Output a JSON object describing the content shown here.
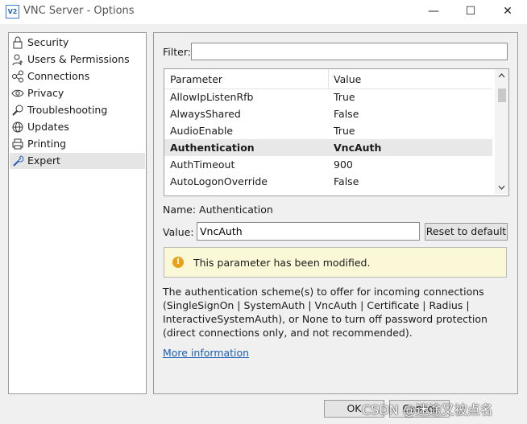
{
  "window": {
    "title": "VNC Server - Options",
    "icon_text": "V2",
    "minimize": "—",
    "maximize": "☐",
    "close": "✕"
  },
  "sidebar": {
    "items": [
      {
        "label": "Security",
        "icon": "lock-icon"
      },
      {
        "label": "Users & Permissions",
        "icon": "user-icon"
      },
      {
        "label": "Connections",
        "icon": "network-icon"
      },
      {
        "label": "Privacy",
        "icon": "eye-icon"
      },
      {
        "label": "Troubleshooting",
        "icon": "wrench-magnifier-icon"
      },
      {
        "label": "Updates",
        "icon": "globe-icon"
      },
      {
        "label": "Printing",
        "icon": "printer-icon"
      },
      {
        "label": "Expert",
        "icon": "wrench-icon"
      }
    ],
    "selected": "Expert"
  },
  "filter": {
    "label": "Filter:",
    "value": ""
  },
  "grid": {
    "headers": [
      "Parameter",
      "Value"
    ],
    "rows": [
      {
        "param": "AllowIpListenRfb",
        "value": "True"
      },
      {
        "param": "AlwaysShared",
        "value": "False"
      },
      {
        "param": "AudioEnable",
        "value": "True"
      },
      {
        "param": "Authentication",
        "value": "VncAuth"
      },
      {
        "param": "AuthTimeout",
        "value": "900"
      },
      {
        "param": "AutoLogonOverride",
        "value": "False"
      }
    ],
    "selected_row": "Authentication"
  },
  "detail": {
    "name_label": "Name: Authentication",
    "value_label": "Value:",
    "value": "VncAuth",
    "reset_button": "Reset to default",
    "warning_text": "This parameter has been modified.",
    "description": "The authentication scheme(s) to offer for incoming connections (SingleSignOn | SystemAuth | VncAuth | Certificate | Radius | InteractiveSystemAuth), or None to turn off password protection (direct connections only, and not recommended).",
    "more_info": "More information"
  },
  "footer": {
    "ok": "OK",
    "cancel": "Cancel",
    "watermark": "CSDN @迷途又被点名"
  },
  "colors": {
    "warning_bg": "#fbf8d7",
    "warning_icon": "#e8a21a",
    "link": "#1a5fb4",
    "selected_row": "#e8e8e8"
  }
}
